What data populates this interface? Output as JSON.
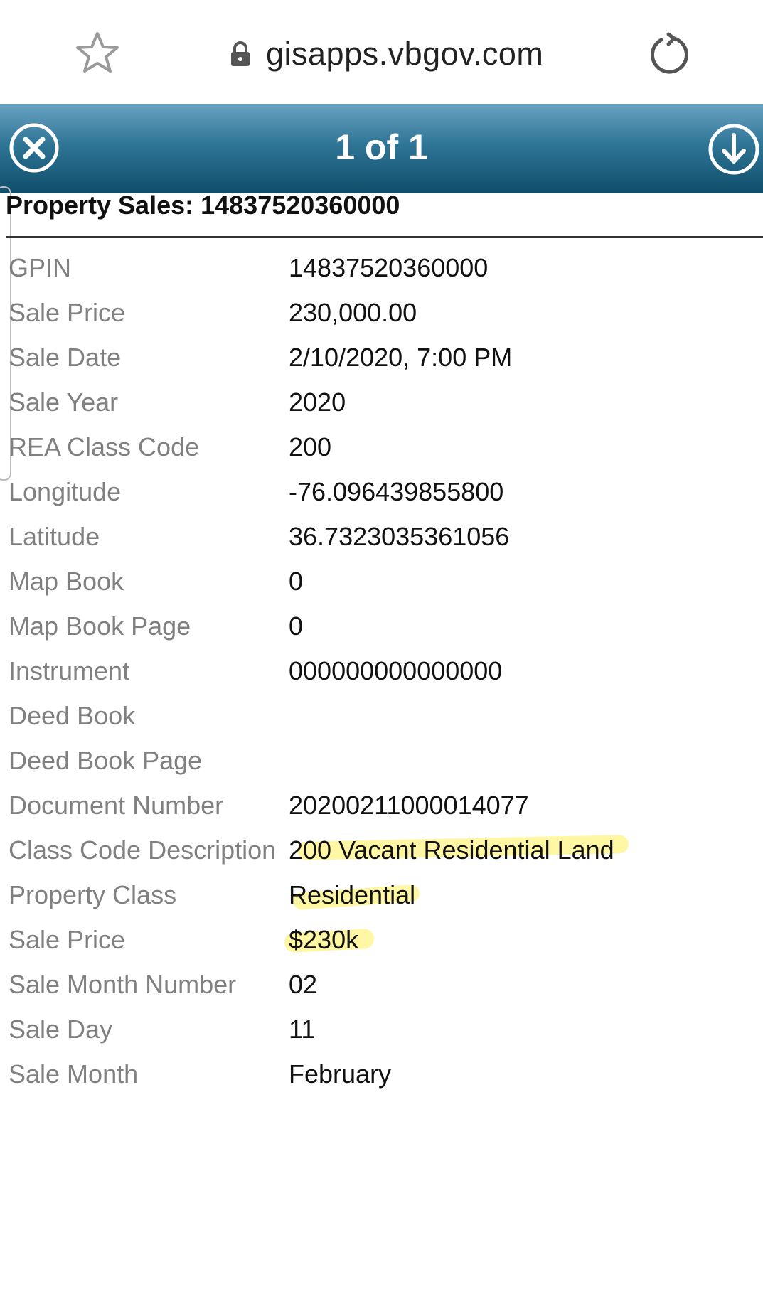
{
  "browser": {
    "url": "gisapps.vbgov.com",
    "icons": {
      "bookmark": "star-outline-icon",
      "secure": "lock-icon",
      "reload": "reload-icon"
    }
  },
  "popup": {
    "header_title": "1 of 1",
    "header_color": "#0f4d6b",
    "highlight_color": "#fff05a",
    "icons": {
      "close": "close-circle-icon",
      "download": "download-circle-icon"
    },
    "title": "Property Sales: 14837520360000",
    "rows": [
      {
        "label": "GPIN",
        "value": "14837520360000"
      },
      {
        "label": "Sale Price",
        "value": "230,000.00"
      },
      {
        "label": "Sale Date",
        "value": "2/10/2020, 7:00 PM"
      },
      {
        "label": "Sale Year",
        "value": "2020"
      },
      {
        "label": "REA Class Code",
        "value": "200"
      },
      {
        "label": "Longitude",
        "value": "-76.096439855800"
      },
      {
        "label": "Latitude",
        "value": "36.7323035361056"
      },
      {
        "label": "Map Book",
        "value": "0"
      },
      {
        "label": "Map Book Page",
        "value": "0"
      },
      {
        "label": "Instrument",
        "value": "000000000000000"
      },
      {
        "label": "Deed Book",
        "value": ""
      },
      {
        "label": "Deed Book Page",
        "value": ""
      },
      {
        "label": "Document Number",
        "value": "20200211000014077"
      },
      {
        "label": "Class Code Description",
        "value": "200 Vacant Residential Land"
      },
      {
        "label": "Property Class",
        "value": "Residential"
      },
      {
        "label": "Sale Price",
        "value": "$230k"
      },
      {
        "label": "Sale Month Number",
        "value": "02"
      },
      {
        "label": "Sale Day",
        "value": "11"
      },
      {
        "label": "Sale Month",
        "value": "February"
      }
    ]
  }
}
